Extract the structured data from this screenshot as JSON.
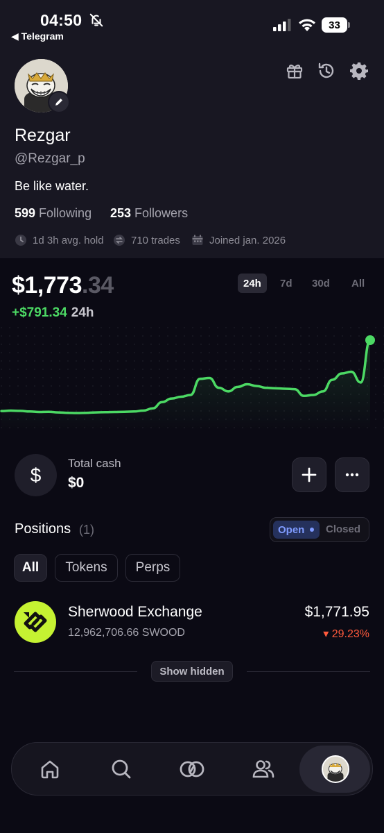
{
  "status_bar": {
    "time": "04:50",
    "back_label": "◀ Telegram",
    "battery": "33"
  },
  "header": {
    "icons": [
      "gift-icon",
      "history-icon",
      "settings-icon"
    ]
  },
  "profile": {
    "name": "Rezgar",
    "handle": "@Rezgar_p",
    "bio": "Be like water.",
    "following_count": "599",
    "following_label": "Following",
    "followers_count": "253",
    "followers_label": "Followers",
    "avg_hold": "1d 3h avg. hold",
    "trades": "710 trades",
    "joined": "Joined jan. 2026"
  },
  "portfolio": {
    "balance_main": "$1,773",
    "balance_cents": ".34",
    "change_amount": "+$791.34",
    "change_period": "24h",
    "ranges": [
      "24h",
      "7d",
      "30d",
      "All"
    ],
    "active_range": "24h"
  },
  "chart_data": {
    "type": "line",
    "title": "",
    "xlabel": "",
    "ylabel": "",
    "values": [
      980,
      985,
      982,
      975,
      970,
      972,
      965,
      960,
      958,
      960,
      965,
      968,
      970,
      972,
      975,
      985,
      1010,
      1080,
      1120,
      1140,
      1160,
      1340,
      1350,
      1240,
      1200,
      1250,
      1280,
      1260,
      1240,
      1235,
      1230,
      1225,
      1150,
      1160,
      1200,
      1330,
      1400,
      1420,
      1300,
      1773
    ],
    "line_color": "#4cd964"
  },
  "cash": {
    "label": "Total cash",
    "value": "$0",
    "add_icon": "plus-icon",
    "more_icon": "more-icon"
  },
  "positions": {
    "title": "Positions",
    "count": "(1)",
    "toggle_open": "Open",
    "toggle_closed": "Closed",
    "filters": [
      "All",
      "Tokens",
      "Perps"
    ],
    "items": [
      {
        "name": "Sherwood Exchange",
        "amount": "12,962,706.66 SWOOD",
        "value": "$1,771.95",
        "change": "▾ 29.23%"
      }
    ],
    "show_hidden": "Show hidden"
  },
  "nav": {
    "items": [
      "home-icon",
      "search-icon",
      "trade-icon",
      "community-icon",
      "profile-avatar"
    ]
  }
}
